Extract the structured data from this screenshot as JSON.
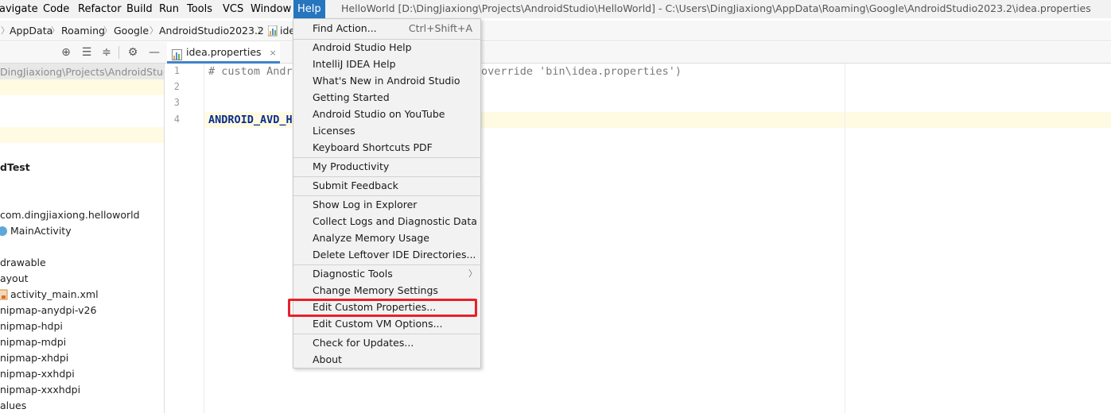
{
  "menubar": {
    "items": [
      "avigate",
      "Code",
      "Refactor",
      "Build",
      "Run",
      "Tools",
      "VCS",
      "Window",
      "Help"
    ],
    "window_title": "HelloWorld [D:\\DingJiaxiong\\Projects\\AndroidStudio\\HelloWorld] - C:\\Users\\DingJiaxiong\\AppData\\Roaming\\Google\\AndroidStudio2023.2\\idea.properties"
  },
  "breadcrumb": [
    "AppData",
    "Roaming",
    "Google",
    "AndroidStudio2023.2",
    "ide"
  ],
  "tab": {
    "label": "idea.properties",
    "close": "×"
  },
  "project_tree": [
    "DingJiaxiong\\Projects\\AndroidStudio",
    "dTest",
    "com.dingjiaxiong.helloworld",
    "MainActivity",
    "drawable",
    "ayout",
    "activity_main.xml",
    "nipmap-anydpi-v26",
    "nipmap-hdpi",
    "nipmap-mdpi",
    "nipmap-xhdpi",
    "nipmap-xxhdpi",
    "nipmap-xxxhdpi",
    "alues"
  ],
  "editor": {
    "line_numbers": [
      "1",
      "2",
      "3",
      "4"
    ],
    "line1_a": "# custom Andro",
    "line1_b": "override 'bin\\idea.properties')",
    "line4": "ANDROID_AVD_HO"
  },
  "help_menu": {
    "find_action": "Find Action...",
    "find_action_shortcut": "Ctrl+Shift+A",
    "items_group1": [
      "Android Studio Help",
      "IntelliJ IDEA Help",
      "What's New in Android Studio",
      "Getting Started",
      "Android Studio on YouTube",
      "Licenses",
      "Keyboard Shortcuts PDF"
    ],
    "my_productivity": "My Productivity",
    "submit_feedback": "Submit Feedback",
    "items_group4": [
      "Show Log in Explorer",
      "Collect Logs and Diagnostic Data",
      "Analyze Memory Usage",
      "Delete Leftover IDE Directories..."
    ],
    "diagnostic_tools": "Diagnostic Tools",
    "change_memory": "Change Memory Settings",
    "edit_custom_properties": "Edit Custom Properties...",
    "edit_custom_vm": "Edit Custom VM Options...",
    "check_updates": "Check for Updates...",
    "about": "About"
  },
  "colors": {
    "accent": "#2675bf",
    "highlight_box": "#e8202a"
  }
}
